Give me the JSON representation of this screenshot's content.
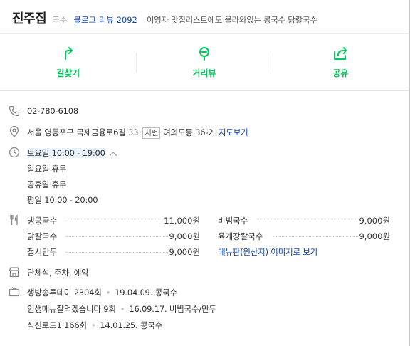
{
  "header": {
    "title": "진주집",
    "category": "국수",
    "blog_review": "블로그 리뷰 2092",
    "description": "이영자 맛집리스트에도 올라와있는 콩국수 닭칼국수"
  },
  "actions": [
    {
      "label": "길찾기",
      "icon": "directions-icon"
    },
    {
      "label": "거리뷰",
      "icon": "street-view-icon"
    },
    {
      "label": "공유",
      "icon": "share-icon"
    }
  ],
  "phone": "02-780-6108",
  "address": {
    "road": "서울 영등포구 국제금융로6길 33",
    "jibun_tag": "지번",
    "jibun": "여의도동 36-2",
    "map_link": "지도보기"
  },
  "hours": {
    "current": "토요일 10:00 - 19:00",
    "lines": [
      "일요일 휴무",
      "공휴일 휴무",
      "평일 10:00 - 20:00"
    ]
  },
  "menu": {
    "left": [
      {
        "name": "냉콩국수",
        "price": "11,000원"
      },
      {
        "name": "닭칼국수",
        "price": "9,000원"
      },
      {
        "name": "접시만두",
        "price": "9,000원"
      }
    ],
    "right": [
      {
        "name": "비빔국수",
        "price": "9,000원"
      },
      {
        "name": "육개장칼국수",
        "price": "9,000원"
      }
    ],
    "more_link": "메뉴판(원산지) 이미지로 보기"
  },
  "facilities": "단체석, 주차, 예약",
  "tv": [
    {
      "show": "생방송투데이 2304회",
      "info": "19.04.09. 콩국수"
    },
    {
      "show": "인생메뉴잘먹겠습니다 9회",
      "info": "16.09.17. 비빔국수/만두"
    },
    {
      "show": "식신로드1 166회",
      "info": "14.01.25. 콩국수"
    }
  ],
  "colors": {
    "accent": "#03c75a",
    "link": "#0c43b7"
  }
}
